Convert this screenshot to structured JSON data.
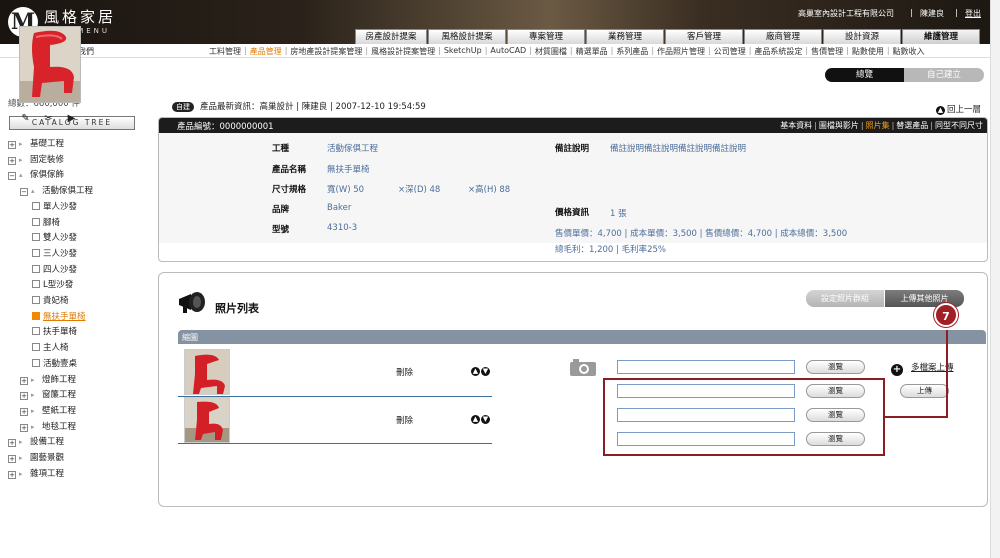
{
  "header": {
    "logo_mark": "M",
    "logo_cn": "風格家居",
    "logo_en": "DECOMENU",
    "company": "高巢室內設計工程有限公司",
    "user": "陳建良",
    "logout": "登出"
  },
  "main_tabs": [
    "房產設計提案",
    "風格設計提案",
    "專案管理",
    "業務管理",
    "客戶管理",
    "廠商管理",
    "設計資源",
    "維護管理"
  ],
  "about": "關於我們",
  "subnav": [
    "工料管理",
    "產品管理",
    "房地產設計提案管理",
    "風格設計提案管理",
    "SketchUp",
    "AutoCAD",
    "材質圖檔",
    "精選單品",
    "系列產品",
    "作品照片管理",
    "公司管理",
    "產品系統設定",
    "售價管理",
    "點數使用",
    "點數收入"
  ],
  "sidebar": {
    "total": "總數：660,000 件",
    "catalog_button": "CATALOG TREE",
    "tree": [
      {
        "label": "基礎工程",
        "type": "box",
        "sym": "+",
        "level": 0
      },
      {
        "label": "固定裝修",
        "type": "box",
        "sym": "+",
        "level": 0
      },
      {
        "label": "傢俱傢飾",
        "type": "box",
        "sym": "−",
        "level": 0
      },
      {
        "label": "活動傢俱工程",
        "type": "box",
        "sym": "−",
        "level": 1
      },
      {
        "label": "單人沙發",
        "type": "leaf",
        "level": 2
      },
      {
        "label": "腳椅",
        "type": "leaf",
        "level": 2
      },
      {
        "label": "雙人沙發",
        "type": "leaf",
        "level": 2
      },
      {
        "label": "三人沙發",
        "type": "leaf",
        "level": 2
      },
      {
        "label": "四人沙發",
        "type": "leaf",
        "level": 2
      },
      {
        "label": "L型沙發",
        "type": "leaf",
        "level": 2
      },
      {
        "label": "貴妃椅",
        "type": "leaf",
        "level": 2
      },
      {
        "label": "無扶手單椅",
        "type": "leaf",
        "level": 2,
        "active": true
      },
      {
        "label": "扶手單椅",
        "type": "leaf",
        "level": 2
      },
      {
        "label": "主人椅",
        "type": "leaf",
        "level": 2
      },
      {
        "label": "活動壹桌",
        "type": "leaf",
        "level": 2
      },
      {
        "label": "燈飾工程",
        "type": "box",
        "sym": "+",
        "level": 1
      },
      {
        "label": "窗簾工程",
        "type": "box",
        "sym": "+",
        "level": 1
      },
      {
        "label": "壁紙工程",
        "type": "box",
        "sym": "+",
        "level": 1
      },
      {
        "label": "地毯工程",
        "type": "box",
        "sym": "+",
        "level": 1
      },
      {
        "label": "設備工程",
        "type": "box",
        "sym": "+",
        "level": 0
      },
      {
        "label": "園藝景觀",
        "type": "box",
        "sym": "+",
        "level": 0
      },
      {
        "label": "雜項工程",
        "type": "box",
        "sym": "+",
        "level": 0
      }
    ]
  },
  "toggles": {
    "overview": "總覽",
    "build": "自己建立"
  },
  "latest": {
    "tag": "自建",
    "text": "產品最新資訊：高巢設計 | 陳建良 | 2007-12-10  19:54:59"
  },
  "back_top": "回上一層",
  "card": {
    "number": "產品編號：0000000001",
    "links": [
      "基本資料",
      "圖檔與影片",
      "照片集",
      "替選產品",
      "同型不同尺寸"
    ],
    "active_link": "照片集",
    "labels": {
      "category": "工種",
      "name": "產品名稱",
      "spec": "尺寸規格",
      "brand": "品牌",
      "model": "型號",
      "remark": "備註說明",
      "price": "價格資訊"
    },
    "values": {
      "category": "活動傢俱工程",
      "name": "無扶手單椅",
      "width": "寬(W)  50",
      "depth": "×深(D) 48",
      "height": "×高(H) 88",
      "brand": "Baker",
      "model": "4310-3",
      "remark": "備註說明備註說明備註說明備註說明",
      "price": "1 張"
    },
    "price_line1": "售價單價：4,700   |   成本單價：3,500   |   售價總價：4,700   |   成本總價：3,500",
    "price_line2": "總毛利：1,200   |   毛利率25%",
    "tools": [
      "✎",
      "✂",
      "▶"
    ]
  },
  "photos": {
    "title": "照片列表",
    "group_button": "設定照片群組",
    "upload_button": "上傳其他照片",
    "thumb_header": "縮圖",
    "rows": [
      {
        "action": "刪除"
      },
      {
        "action": "刪除"
      }
    ],
    "browse": [
      "瀏覽",
      "瀏覽",
      "瀏覽",
      "瀏覽"
    ],
    "multi_upload": "多檔案上傳",
    "upload": "上傳",
    "step": "7"
  }
}
